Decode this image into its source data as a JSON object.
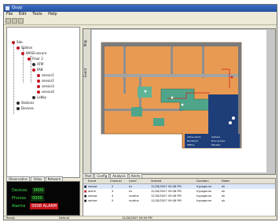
{
  "window": {
    "title": "Quyp"
  },
  "menu": {
    "items": [
      "File",
      "Edit",
      "Tools",
      "Help"
    ]
  },
  "tree": {
    "items": [
      {
        "label": "Site",
        "color": "#c2121e"
      },
      {
        "label": "Station",
        "color": "#c2121e"
      },
      {
        "label": "WASS-secure",
        "color": "#c2121e"
      },
      {
        "label": "Floor 2",
        "color": "#c2121e"
      },
      {
        "label": "ATM",
        "color": "#2b2b2b"
      },
      {
        "label": "PAB",
        "color": "#c2121e"
      },
      {
        "label": "sensor1",
        "color": "#c2121e"
      },
      {
        "label": "sensor2",
        "color": "#c2121e"
      },
      {
        "label": "sensor3",
        "color": "#c2121e"
      },
      {
        "label": "sensor4",
        "color": "#c2121e"
      },
      {
        "label": "Lobby",
        "color": "#2b2b2b"
      },
      {
        "label": "Stations",
        "color": "#2b2b2b"
      },
      {
        "label": "Devices",
        "color": "#2b2b2b"
      }
    ]
  },
  "status_tabs": [
    "Observation",
    "Video",
    "Network"
  ],
  "status": {
    "rows": [
      {
        "label": "Devices",
        "value": "0000",
        "alarm": false
      },
      {
        "label": "Phones",
        "value": "0000",
        "alarm": false
      },
      {
        "label": "Alarms",
        "value": "0008 ALARM",
        "alarm": true
      }
    ]
  },
  "map": {
    "side_labels": [
      "Map",
      "Event"
    ],
    "legend_items": [
      "Active alarm",
      "Monitored",
      "Offline",
      "Camera",
      "Door access",
      "Elevator"
    ]
  },
  "events": {
    "tabs": [
      "Past",
      "Config",
      "Analysis",
      "Alerts"
    ],
    "columns": [
      "Event",
      "Channel",
      "Level",
      "Started",
      "Duration",
      "Notes"
    ],
    "rows": [
      [
        "sensor",
        "2",
        "hv",
        "12/28/2007 09:08 PM",
        "hypogeum",
        "ok"
      ],
      [
        "alarm",
        "3",
        "hv",
        "12/28/2007 09:08 PM",
        "hypogeum",
        "ok"
      ],
      [
        "sensor",
        "4",
        "routine",
        "12/28/2007 09:08 PM",
        "hypogeum",
        "ok"
      ],
      [
        "sensor",
        "5",
        "routine",
        "12/28/2007 09:08 PM",
        "hypogeum",
        "ok"
      ]
    ]
  },
  "statusbar": {
    "left": "Ready",
    "middle": "Default",
    "right": "12/28/2007 09:09 PM"
  },
  "colors": {
    "alarm": "#c5141d",
    "map_orange": "#e89a52",
    "map_green": "#4fa58a",
    "map_blue": "#1e3e7a"
  }
}
